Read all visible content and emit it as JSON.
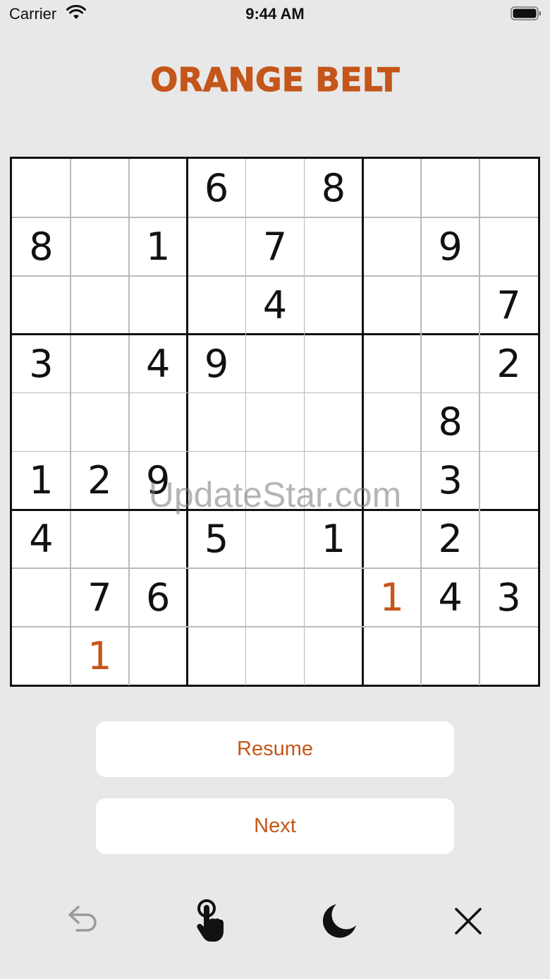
{
  "status_bar": {
    "carrier": "Carrier",
    "time": "9:44 AM"
  },
  "title": "ORANGE BELT",
  "board": {
    "rows": [
      [
        "",
        "",
        "",
        "6",
        "",
        "8",
        "",
        "",
        ""
      ],
      [
        "8",
        "",
        "1",
        "",
        "7",
        "",
        "",
        "9",
        ""
      ],
      [
        "",
        "",
        "",
        "",
        "4",
        "",
        "",
        "",
        "7"
      ],
      [
        "3",
        "",
        "4",
        "9",
        "",
        "",
        "",
        "",
        "2"
      ],
      [
        "",
        "",
        "",
        "",
        "",
        "",
        "",
        "8",
        ""
      ],
      [
        "1",
        "2",
        "9",
        "",
        "",
        "",
        "",
        "3",
        ""
      ],
      [
        "4",
        "",
        "",
        "5",
        "",
        "1",
        "",
        "2",
        ""
      ],
      [
        "",
        "7",
        "6",
        "",
        "",
        "",
        "1",
        "4",
        "3"
      ],
      [
        "",
        "1",
        "",
        "",
        "",
        "",
        "",
        "",
        ""
      ]
    ],
    "entered_cells": [
      [
        7,
        6
      ],
      [
        8,
        1
      ]
    ],
    "given_color": "#111111",
    "entered_color": "#c4561a"
  },
  "watermark": "UpdateStar.com",
  "buttons": {
    "resume": "Resume",
    "next": "Next"
  },
  "toolbar": {
    "icons": [
      "undo-icon",
      "tap-hand-icon",
      "moon-icon",
      "close-icon"
    ]
  },
  "colors": {
    "accent": "#c4561a",
    "background": "#e8e8e8"
  }
}
